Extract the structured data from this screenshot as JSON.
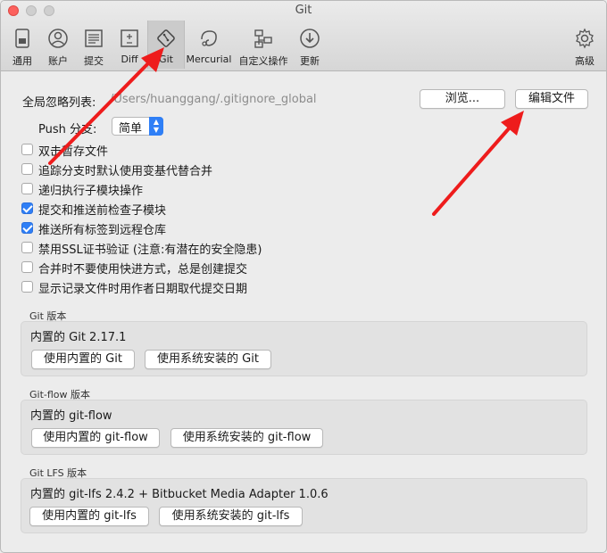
{
  "window": {
    "title": "Git"
  },
  "toolbar": {
    "items": [
      {
        "label": "通用",
        "icon": "general-icon"
      },
      {
        "label": "账户",
        "icon": "account-icon"
      },
      {
        "label": "提交",
        "icon": "commit-icon"
      },
      {
        "label": "Diff",
        "icon": "diff-icon"
      },
      {
        "label": "Git",
        "icon": "git-icon",
        "selected": true
      },
      {
        "label": "Mercurial",
        "icon": "mercurial-icon"
      },
      {
        "label": "自定义操作",
        "icon": "custom-actions-icon"
      },
      {
        "label": "更新",
        "icon": "update-icon"
      },
      {
        "label": "高级",
        "icon": "gear-icon"
      }
    ]
  },
  "ignore": {
    "label": "全局忽略列表:",
    "path": "/Users/huanggang/.gitignore_global",
    "browse_button": "浏览...",
    "edit_button": "编辑文件"
  },
  "push": {
    "label": "Push 分支:",
    "selected": "简单"
  },
  "options": [
    {
      "label": "双击暂存文件",
      "checked": false
    },
    {
      "label": "追踪分支时默认使用变基代替合并",
      "checked": false
    },
    {
      "label": "递归执行子模块操作",
      "checked": false
    },
    {
      "label": "提交和推送前检查子模块",
      "checked": true
    },
    {
      "label": "推送所有标签到远程仓库",
      "checked": true
    },
    {
      "label": "禁用SSL证书验证 (注意:有潜在的安全隐患)",
      "checked": false
    },
    {
      "label": "合并时不要使用快进方式，总是创建提交",
      "checked": false
    },
    {
      "label": "显示记录文件时用作者日期取代提交日期",
      "checked": false
    }
  ],
  "git_version": {
    "title": "Git 版本",
    "current": "内置的 Git 2.17.1",
    "builtin_button": "使用内置的 Git",
    "system_button": "使用系统安装的 Git"
  },
  "gitflow_version": {
    "title": "Git-flow 版本",
    "current": "内置的 git-flow",
    "builtin_button": "使用内置的 git-flow",
    "system_button": "使用系统安装的 git-flow"
  },
  "gitlfs_version": {
    "title": "Git LFS 版本",
    "current": "内置的 git-lfs 2.4.2 + Bitbucket Media Adapter 1.0.6",
    "builtin_button": "使用内置的 git-lfs",
    "system_button": "使用系统安装的 git-lfs"
  },
  "colors": {
    "accent": "#2f7ff6",
    "annotation_arrow": "#ee1c1c"
  }
}
